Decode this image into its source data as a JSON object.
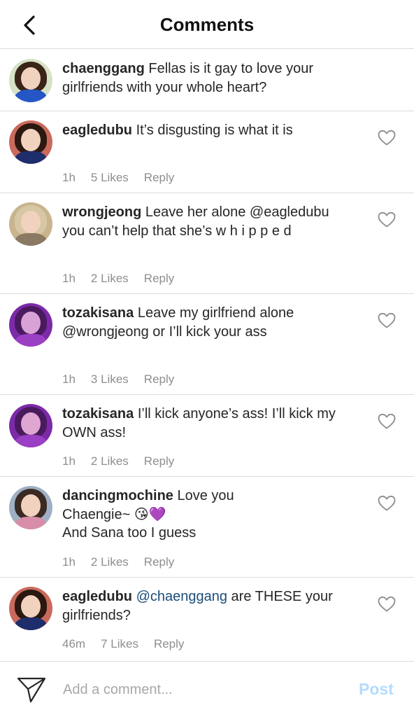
{
  "header": {
    "title": "Comments"
  },
  "caption": {
    "username": "chaenggang",
    "text": " Fellas is it gay to love your girlfriends with your whole heart?"
  },
  "comments": [
    {
      "username": "eagledubu",
      "text": " It’s disgusting is what it is",
      "time": "1h",
      "likes": "5 Likes",
      "reply": "Reply"
    },
    {
      "username": "wrongjeong",
      "text": " Leave her alone @eagledubu you can’t help that she’s w h i p p e d",
      "time": "1h",
      "likes": "2 Likes",
      "reply": "Reply"
    },
    {
      "username": "tozakisana",
      "text": " Leave my girlfriend alone @wrongjeong or I’ll kick your ass",
      "time": "1h",
      "likes": "3 Likes",
      "reply": "Reply"
    },
    {
      "username": "tozakisana",
      "text": " I’ll kick anyone’s ass! I’ll kick my OWN ass!",
      "time": "1h",
      "likes": "2 Likes",
      "reply": "Reply"
    },
    {
      "username": "dancingmochine",
      "text_line1": " Love you",
      "text_line2": "Chaengie~ 😘💜",
      "text_line3": "And Sana too I guess",
      "time": "1h",
      "likes": "2 Likes",
      "reply": "Reply"
    },
    {
      "username": "eagledubu",
      "mention": "@chaenggang",
      "text": " are THESE your girlfriends?",
      "time": "46m",
      "likes": "7 Likes",
      "reply": "Reply"
    }
  ],
  "footer": {
    "placeholder": "Add a comment...",
    "post_label": "Post"
  },
  "colors": {
    "mention": "#1c4c7a",
    "post_disabled": "#b3dbff",
    "meta": "#8e8e8e",
    "divider": "#dbdbdb"
  },
  "icons": {
    "back": "chevron-left-icon",
    "like": "heart-outline-icon",
    "send": "paper-plane-icon"
  }
}
